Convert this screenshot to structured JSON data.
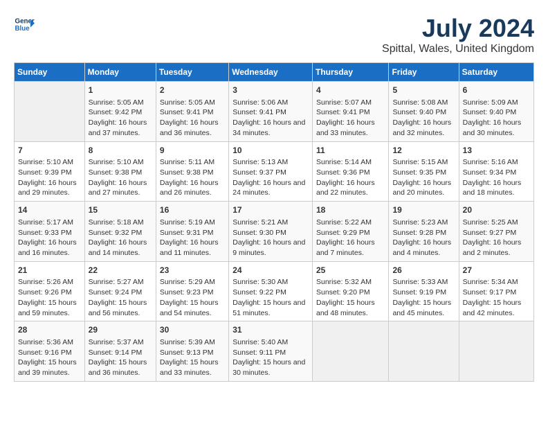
{
  "logo": {
    "line1": "General",
    "line2": "Blue"
  },
  "title": "July 2024",
  "subtitle": "Spittal, Wales, United Kingdom",
  "days_header": [
    "Sunday",
    "Monday",
    "Tuesday",
    "Wednesday",
    "Thursday",
    "Friday",
    "Saturday"
  ],
  "weeks": [
    [
      {
        "day": "",
        "content": ""
      },
      {
        "day": "1",
        "content": "Sunrise: 5:05 AM\nSunset: 9:42 PM\nDaylight: 16 hours\nand 37 minutes."
      },
      {
        "day": "2",
        "content": "Sunrise: 5:05 AM\nSunset: 9:41 PM\nDaylight: 16 hours\nand 36 minutes."
      },
      {
        "day": "3",
        "content": "Sunrise: 5:06 AM\nSunset: 9:41 PM\nDaylight: 16 hours\nand 34 minutes."
      },
      {
        "day": "4",
        "content": "Sunrise: 5:07 AM\nSunset: 9:41 PM\nDaylight: 16 hours\nand 33 minutes."
      },
      {
        "day": "5",
        "content": "Sunrise: 5:08 AM\nSunset: 9:40 PM\nDaylight: 16 hours\nand 32 minutes."
      },
      {
        "day": "6",
        "content": "Sunrise: 5:09 AM\nSunset: 9:40 PM\nDaylight: 16 hours\nand 30 minutes."
      }
    ],
    [
      {
        "day": "7",
        "content": "Sunrise: 5:10 AM\nSunset: 9:39 PM\nDaylight: 16 hours\nand 29 minutes."
      },
      {
        "day": "8",
        "content": "Sunrise: 5:10 AM\nSunset: 9:38 PM\nDaylight: 16 hours\nand 27 minutes."
      },
      {
        "day": "9",
        "content": "Sunrise: 5:11 AM\nSunset: 9:38 PM\nDaylight: 16 hours\nand 26 minutes."
      },
      {
        "day": "10",
        "content": "Sunrise: 5:13 AM\nSunset: 9:37 PM\nDaylight: 16 hours\nand 24 minutes."
      },
      {
        "day": "11",
        "content": "Sunrise: 5:14 AM\nSunset: 9:36 PM\nDaylight: 16 hours\nand 22 minutes."
      },
      {
        "day": "12",
        "content": "Sunrise: 5:15 AM\nSunset: 9:35 PM\nDaylight: 16 hours\nand 20 minutes."
      },
      {
        "day": "13",
        "content": "Sunrise: 5:16 AM\nSunset: 9:34 PM\nDaylight: 16 hours\nand 18 minutes."
      }
    ],
    [
      {
        "day": "14",
        "content": "Sunrise: 5:17 AM\nSunset: 9:33 PM\nDaylight: 16 hours\nand 16 minutes."
      },
      {
        "day": "15",
        "content": "Sunrise: 5:18 AM\nSunset: 9:32 PM\nDaylight: 16 hours\nand 14 minutes."
      },
      {
        "day": "16",
        "content": "Sunrise: 5:19 AM\nSunset: 9:31 PM\nDaylight: 16 hours\nand 11 minutes."
      },
      {
        "day": "17",
        "content": "Sunrise: 5:21 AM\nSunset: 9:30 PM\nDaylight: 16 hours\nand 9 minutes."
      },
      {
        "day": "18",
        "content": "Sunrise: 5:22 AM\nSunset: 9:29 PM\nDaylight: 16 hours\nand 7 minutes."
      },
      {
        "day": "19",
        "content": "Sunrise: 5:23 AM\nSunset: 9:28 PM\nDaylight: 16 hours\nand 4 minutes."
      },
      {
        "day": "20",
        "content": "Sunrise: 5:25 AM\nSunset: 9:27 PM\nDaylight: 16 hours\nand 2 minutes."
      }
    ],
    [
      {
        "day": "21",
        "content": "Sunrise: 5:26 AM\nSunset: 9:26 PM\nDaylight: 15 hours\nand 59 minutes."
      },
      {
        "day": "22",
        "content": "Sunrise: 5:27 AM\nSunset: 9:24 PM\nDaylight: 15 hours\nand 56 minutes."
      },
      {
        "day": "23",
        "content": "Sunrise: 5:29 AM\nSunset: 9:23 PM\nDaylight: 15 hours\nand 54 minutes."
      },
      {
        "day": "24",
        "content": "Sunrise: 5:30 AM\nSunset: 9:22 PM\nDaylight: 15 hours\nand 51 minutes."
      },
      {
        "day": "25",
        "content": "Sunrise: 5:32 AM\nSunset: 9:20 PM\nDaylight: 15 hours\nand 48 minutes."
      },
      {
        "day": "26",
        "content": "Sunrise: 5:33 AM\nSunset: 9:19 PM\nDaylight: 15 hours\nand 45 minutes."
      },
      {
        "day": "27",
        "content": "Sunrise: 5:34 AM\nSunset: 9:17 PM\nDaylight: 15 hours\nand 42 minutes."
      }
    ],
    [
      {
        "day": "28",
        "content": "Sunrise: 5:36 AM\nSunset: 9:16 PM\nDaylight: 15 hours\nand 39 minutes."
      },
      {
        "day": "29",
        "content": "Sunrise: 5:37 AM\nSunset: 9:14 PM\nDaylight: 15 hours\nand 36 minutes."
      },
      {
        "day": "30",
        "content": "Sunrise: 5:39 AM\nSunset: 9:13 PM\nDaylight: 15 hours\nand 33 minutes."
      },
      {
        "day": "31",
        "content": "Sunrise: 5:40 AM\nSunset: 9:11 PM\nDaylight: 15 hours\nand 30 minutes."
      },
      {
        "day": "",
        "content": ""
      },
      {
        "day": "",
        "content": ""
      },
      {
        "day": "",
        "content": ""
      }
    ]
  ]
}
